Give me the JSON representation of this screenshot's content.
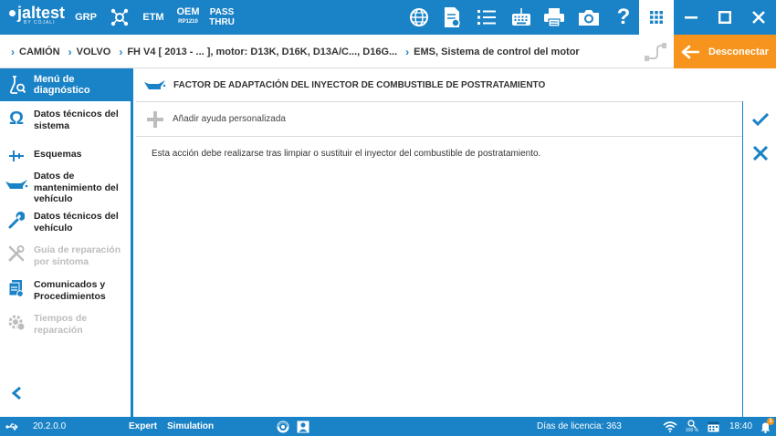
{
  "app": {
    "logo_text": "jaltest",
    "logo_sub": "BY COJALI"
  },
  "topnav": {
    "grp": "GRP",
    "etm": "ETM",
    "oem_line1": "OEM",
    "oem_line2": "RP1210",
    "pass_line1": "PASS",
    "pass_line2": "THRU"
  },
  "breadcrumb": [
    {
      "label": "CAMIÓN"
    },
    {
      "label": "VOLVO"
    },
    {
      "label": "FH V4 [ 2013 - ... ], motor: D13K, D16K, D13A/C..., D16G..."
    },
    {
      "label": "EMS, Sistema de control del motor"
    }
  ],
  "disconnect": {
    "label": "Desconectar"
  },
  "sidebar": {
    "header": "Menú de diagnóstico",
    "items": [
      {
        "label": "Datos técnicos del sistema",
        "icon": "omega-icon",
        "disabled": false
      },
      {
        "label": "Esquemas",
        "icon": "schematic-icon",
        "disabled": false
      },
      {
        "label": "Datos de mantenimiento del vehículo",
        "icon": "oil-can-icon",
        "disabled": false
      },
      {
        "label": "Datos técnicos del vehículo",
        "icon": "wrench-icon",
        "disabled": false
      },
      {
        "label": "Guía de reparación por síntoma",
        "icon": "tools-icon",
        "disabled": true
      },
      {
        "label": "Comunicados y Procedimientos",
        "icon": "documents-icon",
        "disabled": false
      },
      {
        "label": "Tiempos de reparación",
        "icon": "gear-clock-icon",
        "disabled": true
      }
    ]
  },
  "main": {
    "title": "FACTOR DE ADAPTACIÓN DEL INYECTOR DE COMBUSTIBLE DE POSTRATAMIENTO",
    "add_help": "Añadir ayuda personalizada",
    "description": "Esta acción debe realizarse tras limpiar o sustituir el inyector del combustible de postratamiento."
  },
  "status": {
    "version": "20.2.0.0",
    "mode": "Expert",
    "simulation": "Simulation",
    "license": "Días de licencia: 363",
    "zoom": "100 %",
    "time": "18:40",
    "notifications": "1"
  },
  "colors": {
    "primary": "#1a82c6",
    "accent": "#f7941d",
    "disabled": "#bdbdbd"
  }
}
